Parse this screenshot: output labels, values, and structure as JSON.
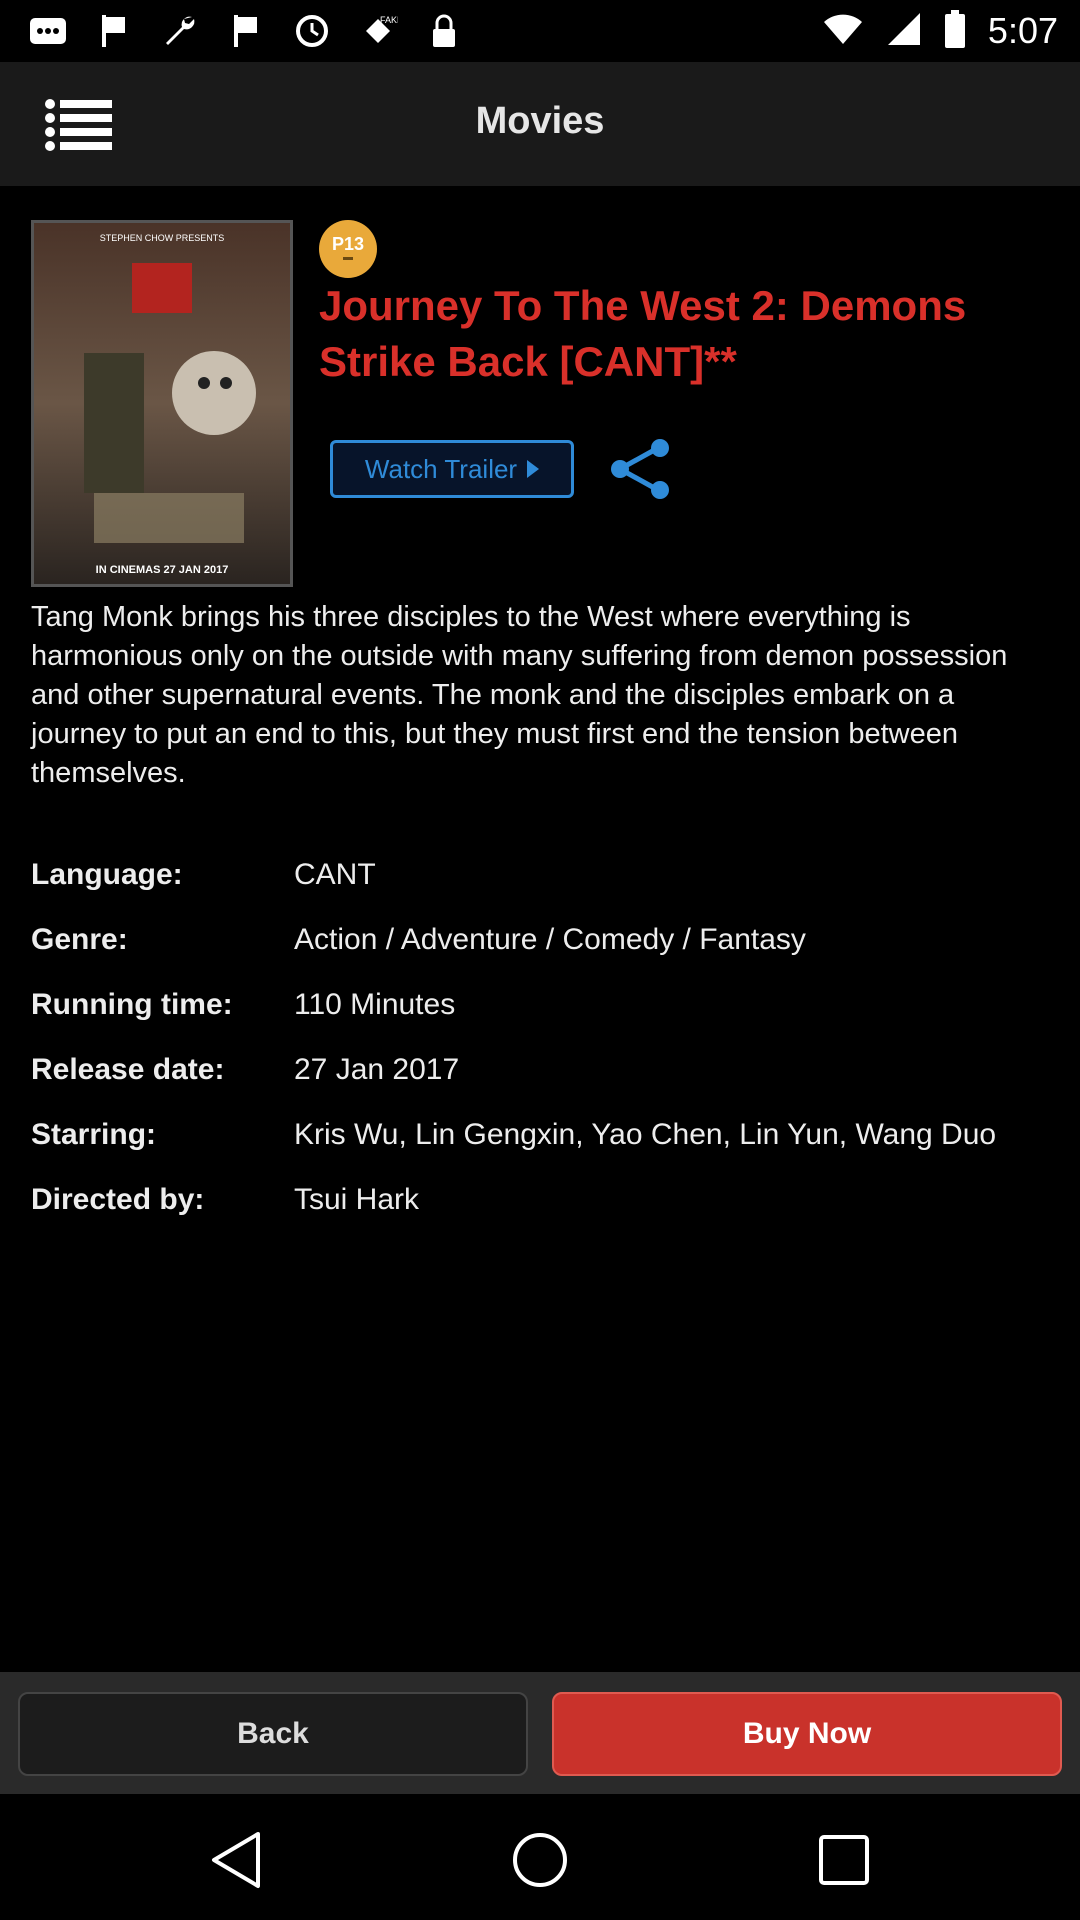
{
  "status_bar": {
    "time": "5:07",
    "icons": [
      "messages-icon",
      "flag-icon",
      "wrench-icon",
      "flag-icon",
      "sync-icon",
      "gps-icon",
      "lock-icon",
      "wifi-icon",
      "signal-icon",
      "battery-icon"
    ]
  },
  "header": {
    "title": "Movies",
    "menu_icon": "list-menu-icon"
  },
  "movie": {
    "rating_badge": "P13",
    "title": "Journey To The West 2: Demons Strike Back [CANT]**",
    "trailer_label": "Watch Trailer",
    "synopsis": "Tang Monk brings his three disciples to the West where everything is harmonious only on the outside with many suffering from demon possession and other supernatural events. The monk and the disciples embark on a journey to put an end to this, but they must first end the tension between themselves.",
    "poster_caption": "IN CINEMAS 27 JAN 2017",
    "poster_top_text": "STEPHEN CHOW PRESENTS",
    "details": [
      {
        "label": "Language:",
        "value": "CANT"
      },
      {
        "label": "Genre:",
        "value": "Action / Adventure / Comedy / Fantasy"
      },
      {
        "label": "Running time:",
        "value": "110 Minutes"
      },
      {
        "label": "Release date:",
        "value": "27 Jan 2017"
      },
      {
        "label": "Starring:",
        "value": "Kris Wu, Lin Gengxin, Yao Chen, Lin Yun, Wang Duo"
      },
      {
        "label": "Directed by:",
        "value": "Tsui Hark"
      }
    ]
  },
  "bottom_bar": {
    "back_label": "Back",
    "buy_label": "Buy Now"
  },
  "colors": {
    "accent_red": "#d9302a",
    "accent_blue": "#2f8bd8",
    "rating_orange": "#e9a93a"
  }
}
